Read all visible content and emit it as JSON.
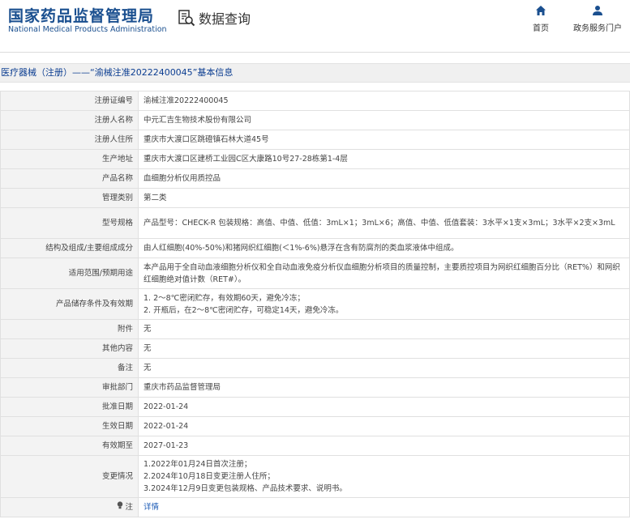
{
  "header": {
    "logo_cn": "国家药品监督管理局",
    "logo_en": "National Medical Products Administration",
    "query_title": "数据查询",
    "nav": {
      "home": "首页",
      "service": "政务服务门户"
    }
  },
  "page_title": "医疗器械（注册）——“渝械注准20222400045”基本信息",
  "fields": [
    {
      "label": "注册证编号",
      "value": "渝械注准20222400045"
    },
    {
      "label": "注册人名称",
      "value": "中元汇吉生物技术股份有限公司"
    },
    {
      "label": "注册人住所",
      "value": "重庆市大渡口区跳磴镇石林大道45号"
    },
    {
      "label": "生产地址",
      "value": "重庆市大渡口区建桥工业园C区大康路10号27-28栋第1-4层"
    },
    {
      "label": "产品名称",
      "value": "血细胞分析仪用质控品"
    },
    {
      "label": "管理类别",
      "value": "第二类"
    },
    {
      "label": "型号规格",
      "value": "产品型号：CHECK-R 包装规格：高值、中值、低值：3mL×1；3mL×6；高值、中值、低值套装：3水平×1支×3mL；3水平×2支×3mL"
    },
    {
      "label": "结构及组成/主要组成成分",
      "value": "由人红细胞(40%-50%)和猪网织红细胞(＜1%-6%)悬浮在含有防腐剂的类血浆液体中组成。"
    },
    {
      "label": "适用范围/预期用途",
      "value": "本产品用于全自动血液细胞分析仪和全自动血液免疫分析仪血细胞分析项目的质量控制，主要质控项目为网织红细胞百分比（RET%）和网织红细胞绝对值计数（RET#）。"
    },
    {
      "label": "产品储存条件及有效期",
      "lines": [
        "1. 2～8℃密闭贮存，有效期60天，避免冷冻；",
        "2. 开瓶后，在2～8℃密闭贮存，可稳定14天，避免冷冻。"
      ]
    },
    {
      "label": "附件",
      "value": "无"
    },
    {
      "label": "其他内容",
      "value": "无"
    },
    {
      "label": "备注",
      "value": "无"
    },
    {
      "label": "审批部门",
      "value": "重庆市药品监督管理局"
    },
    {
      "label": "批准日期",
      "value": "2022-01-24"
    },
    {
      "label": "生效日期",
      "value": "2022-01-24"
    },
    {
      "label": "有效期至",
      "value": "2027-01-23"
    },
    {
      "label": "变更情况",
      "lines": [
        "1.2022年01月24日首次注册；",
        "2.2024年10月18日变更注册人住所；",
        "3.2024年12月9日变更包装规格、产品技术要求、说明书。"
      ]
    },
    {
      "label": "注",
      "icon": "info-bulb-icon",
      "link": "详情"
    }
  ],
  "colors": {
    "brand_blue": "#1a4f8f",
    "link_blue": "#1a5ab5",
    "label_bg": "#f3f3f3"
  }
}
